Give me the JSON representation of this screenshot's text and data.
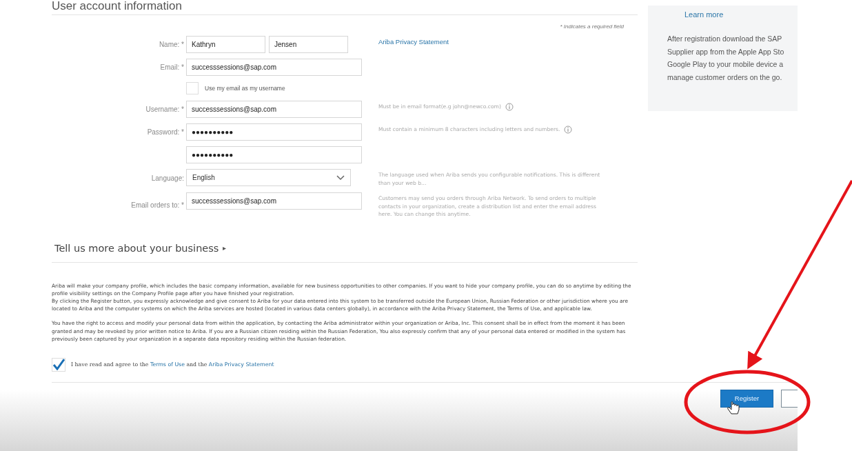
{
  "section_title": "User account information",
  "required_note": "*  Indicates a required field",
  "fields": [
    {
      "kind": "name",
      "label": "Name: *",
      "values": [
        "Kathryn",
        "Jensen"
      ],
      "link": "Ariba Privacy Statement"
    },
    {
      "kind": "text",
      "label": "Email: *",
      "value": "successsessions@sap.com"
    },
    {
      "kind": "checkbox",
      "label": "Use my email as my username",
      "checked": false
    },
    {
      "kind": "text",
      "label": "Username: *",
      "value": "successsessions@sap.com",
      "help": "Must be in email format(e.g john@newco.com)",
      "info": true
    },
    {
      "kind": "text",
      "label": "Password: *",
      "value": "●●●●●●●●●●",
      "help": "Must contain a minimum 8 characters including letters and numbers.",
      "info": true
    },
    {
      "kind": "text",
      "value": "●●●●●●●●●●"
    },
    {
      "kind": "select",
      "label": "Language:",
      "value": "English",
      "help": "The language used when Ariba sends you configurable notifications. This is different than your web b..."
    },
    {
      "kind": "text",
      "label": "Email orders to: *",
      "value": "successsessions@sap.com",
      "help": "Customers may send you orders through Ariba Network. To send orders to multiple contacts in your organization, create a distribution list and enter the email address here. You can change this anytime."
    }
  ],
  "sidebar": {
    "link": "Learn more",
    "lines": [
      "After registration download the SAP",
      "Supplier app from the Apple App Sto",
      "Google Play to your mobile device a",
      "manage customer orders on the go."
    ]
  },
  "business_heading": {
    "title": "Tell us more about your business",
    "toggle": "▸"
  },
  "legal": [
    "Ariba will make your company profile, which includes the basic company information, available for new business opportunities to other companies. If you want to hide your company profile, you can do so anytime by editing the profile visibility settings on the Company Profile page after you have finished your registration.",
    "By clicking the Register button, you expressly acknowledge and give consent to Ariba for your data entered into this system to be transferred outside the European Union, Russian Federation or other jurisdiction where you are located to Ariba and the computer systems on which the Ariba services are hosted (located in various data centers globally), in accordance with the Ariba Privacy Statement, the Terms of Use, and applicable law.",
    "You have the right to access and modify your personal data from within the application, by contacting the Ariba administrator within your organization or Ariba, Inc. This consent shall be in effect from the moment it has been granted and may be revoked by prior written notice to Ariba. If you are a Russian citizen residing within the Russian Federation, You also expressly confirm that any of your personal data entered or modified in the system has previously been captured by your organization in a separate data repository residing within the Russian federation."
  ],
  "agree": {
    "checked": true,
    "parts": [
      {
        "kind": "text",
        "text": "I have read and agree to the "
      },
      {
        "kind": "link",
        "text": "Terms of Use"
      },
      {
        "kind": "text",
        "text": " and the "
      },
      {
        "kind": "link",
        "text": "Ariba Privacy Statement"
      }
    ]
  },
  "register_button": "Register"
}
